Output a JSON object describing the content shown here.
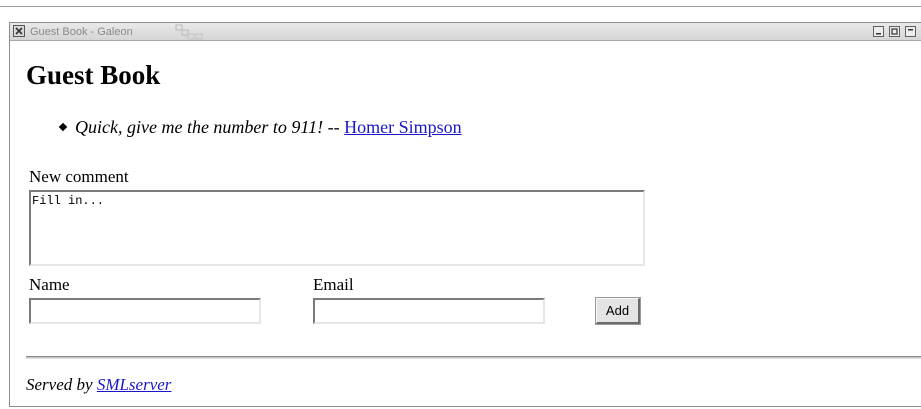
{
  "window": {
    "title": "Guest Book - Galeon"
  },
  "page": {
    "heading": "Guest Book",
    "quotes": [
      {
        "text": "Quick, give me the number to 911!",
        "separator": " -- ",
        "author": "Homer Simpson"
      }
    ]
  },
  "form": {
    "comment_label": "New comment",
    "comment_value": "Fill in...",
    "name_label": "Name",
    "name_value": "",
    "email_label": "Email",
    "email_value": "",
    "add_button": "Add"
  },
  "footer": {
    "served_by": "Served by",
    "server_link": "SMLserver"
  }
}
